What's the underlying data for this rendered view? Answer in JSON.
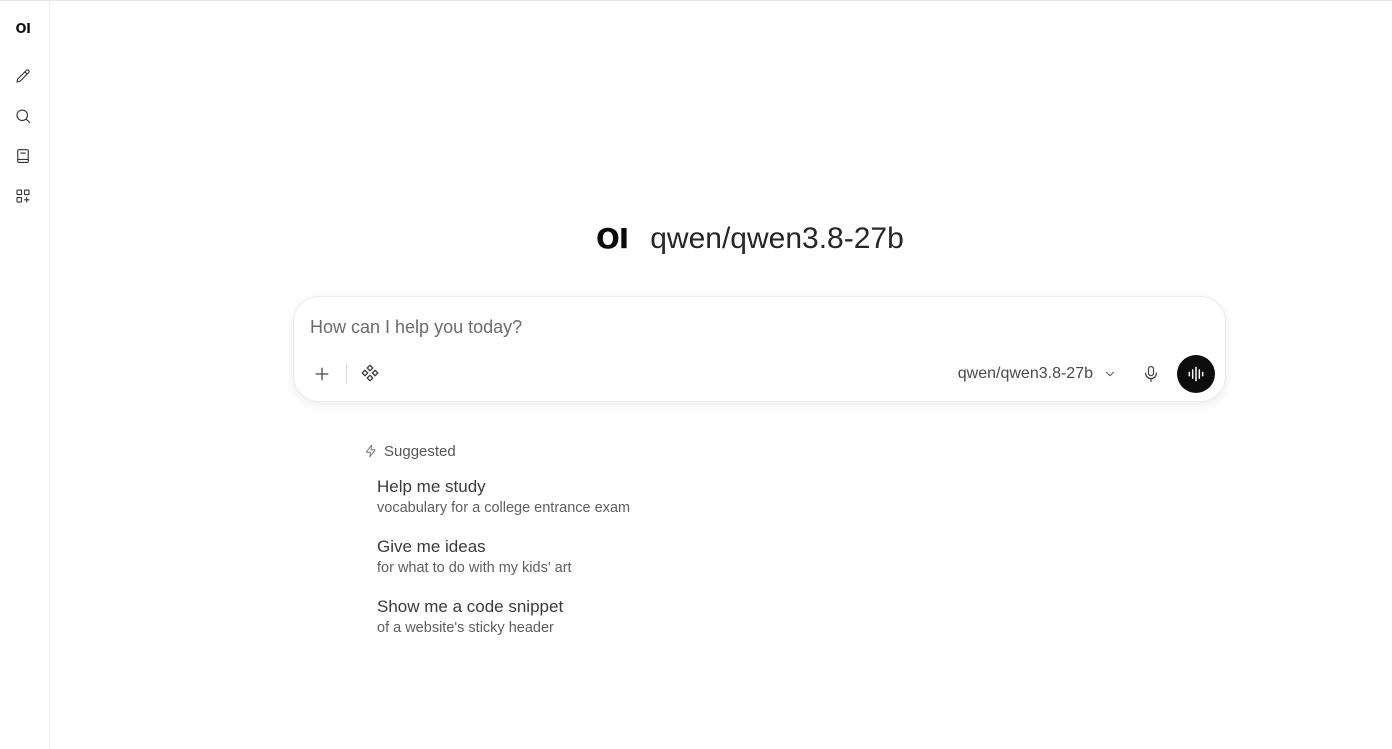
{
  "sidebar": {
    "logo": "OI",
    "items": [
      {
        "name": "new-chat",
        "icon": "pencil-icon"
      },
      {
        "name": "search",
        "icon": "search-icon"
      },
      {
        "name": "notes",
        "icon": "notebook-icon"
      },
      {
        "name": "workspace",
        "icon": "apps-icon"
      }
    ]
  },
  "hero": {
    "logo": "OI",
    "model_title": "qwen/qwen3.8-27b"
  },
  "chat": {
    "placeholder": "How can I help you today?",
    "value": "",
    "selected_model": "qwen/qwen3.8-27b",
    "icons": {
      "add": "plus-icon",
      "tools": "integrations-icon",
      "model_dropdown": "chevron-down-icon",
      "dictate": "microphone-icon",
      "voice_mode": "waveform-icon"
    },
    "colors": {
      "voice_button_bg": "#0d0d0d"
    }
  },
  "suggestions": {
    "header": "Suggested",
    "header_icon": "bolt-icon",
    "items": [
      {
        "title": "Help me study",
        "subtitle": "vocabulary for a college entrance exam"
      },
      {
        "title": "Give me ideas",
        "subtitle": "for what to do with my kids' art"
      },
      {
        "title": "Show me a code snippet",
        "subtitle": "of a website's sticky header"
      }
    ]
  }
}
